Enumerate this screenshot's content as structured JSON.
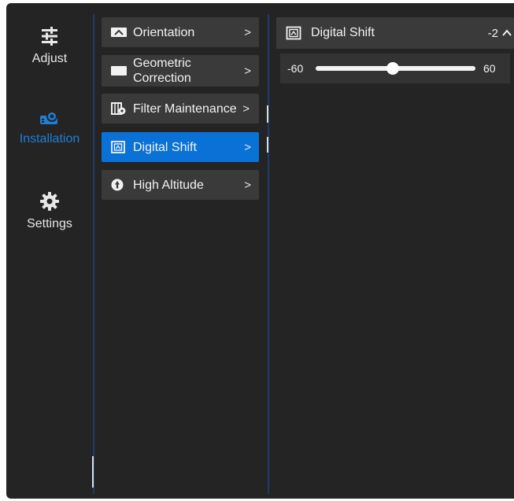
{
  "nav": {
    "items": [
      {
        "label": "Adjust",
        "icon": "sliders-icon",
        "active": false
      },
      {
        "label": "Installation",
        "icon": "projector-icon",
        "active": true
      },
      {
        "label": "Settings",
        "icon": "gear-icon",
        "active": false
      }
    ]
  },
  "menu": {
    "items": [
      {
        "label": "Orientation",
        "icon": "orientation-icon",
        "chevron": ">"
      },
      {
        "label": "Geometric\nCorrection",
        "icon": "geometric-icon",
        "chevron": ">"
      },
      {
        "label": "Filter Maintenance",
        "icon": "filter-icon",
        "chevron": ">"
      },
      {
        "label": "Digital Shift",
        "icon": "digital-shift-icon",
        "chevron": ">"
      },
      {
        "label": "High Altitude",
        "icon": "altitude-icon",
        "chevron": ">"
      }
    ],
    "active_index": 3
  },
  "panel": {
    "title": "Digital Shift",
    "value": "-2",
    "collapse_glyph": "^",
    "slider": {
      "min_label": "-60",
      "max_label": "60",
      "min": -60,
      "max": 60,
      "value": -2
    }
  },
  "colors": {
    "background": "#242424",
    "accent": "#0a72d6",
    "active_nav_text": "#1f7fd6",
    "item_bg": "#3a3a3a"
  }
}
